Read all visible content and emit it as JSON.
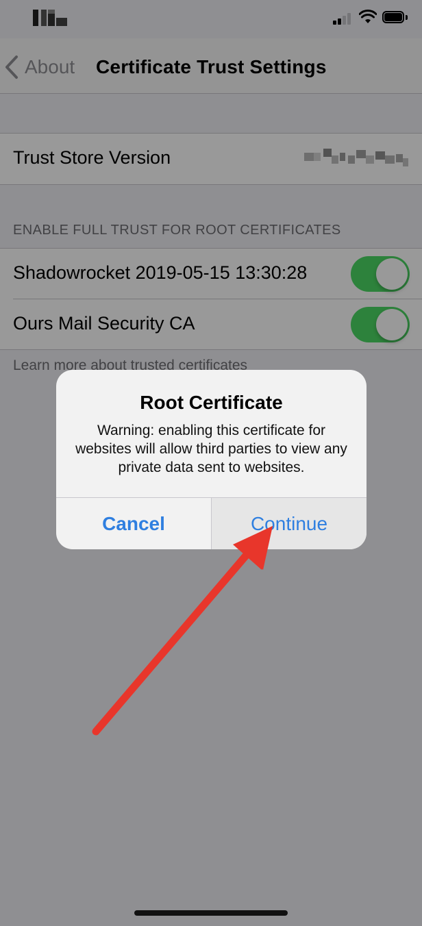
{
  "nav": {
    "back_label": "About",
    "title": "Certificate Trust Settings"
  },
  "trust_store": {
    "label": "Trust Store Version",
    "value_obscured": true
  },
  "section": {
    "header": "ENABLE FULL TRUST FOR ROOT CERTIFICATES",
    "items": [
      {
        "label": "Shadowrocket 2019-05-15 13:30:28",
        "enabled": true
      },
      {
        "label": "Ours Mail Security  CA",
        "enabled": true
      }
    ],
    "footer": "Learn more about trusted certificates"
  },
  "alert": {
    "title": "Root Certificate",
    "message": "Warning: enabling this certificate for websites will allow third parties to view any private data sent to websites.",
    "cancel_label": "Cancel",
    "continue_label": "Continue"
  },
  "colors": {
    "accent": "#007aff",
    "toggle_on": "#4cd964",
    "arrow": "#e8362b"
  },
  "icons": {
    "back": "chevron-left-icon",
    "signal": "cellular-signal-icon",
    "wifi": "wifi-icon",
    "battery": "battery-icon"
  }
}
